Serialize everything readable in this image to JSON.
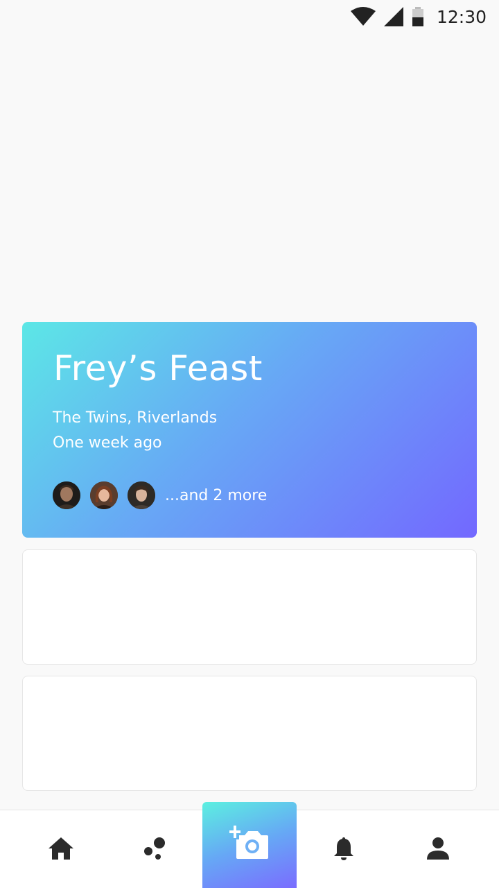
{
  "status_bar": {
    "time": "12:30",
    "icons": [
      "wifi-icon",
      "signal-icon",
      "battery-icon"
    ]
  },
  "event_card": {
    "title": "Frey’s Feast",
    "location": "The Twins, Riverlands",
    "time_ago": "One week ago",
    "attendees": [
      "avatar-1",
      "avatar-2",
      "avatar-3"
    ],
    "more_text": "...and 2 more",
    "gradient": [
      "#5ce7e6",
      "#67a9f5",
      "#7368ff"
    ]
  },
  "bottom_nav": {
    "items": [
      {
        "icon": "home-icon"
      },
      {
        "icon": "bubbles-icon"
      },
      {
        "icon": "add-photo-icon"
      },
      {
        "icon": "bell-icon"
      },
      {
        "icon": "person-icon"
      }
    ],
    "accent_gradient": [
      "#5cf0e0",
      "#66a8f5",
      "#7a6cff"
    ]
  }
}
